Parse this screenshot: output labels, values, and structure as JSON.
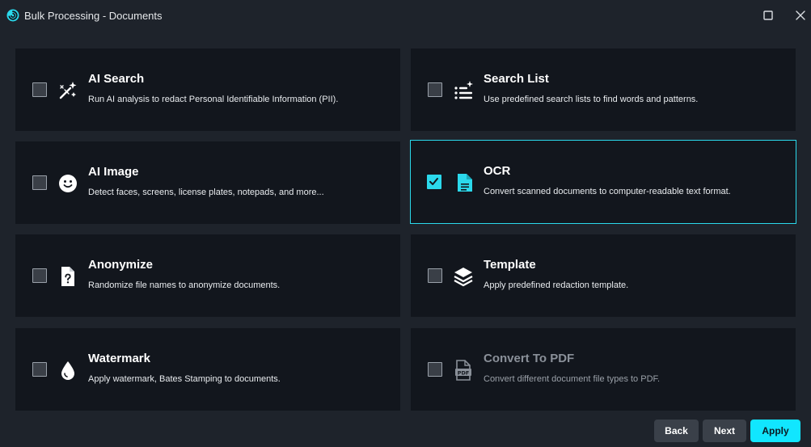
{
  "window": {
    "title": "Bulk Processing - Documents",
    "accent_color": "#2bd9ec"
  },
  "cards": [
    {
      "id": "ai-search",
      "title": "AI Search",
      "description": "Run AI analysis to redact Personal Identifiable Information (PII).",
      "icon": "magic-wand-icon",
      "checked": false,
      "disabled": false
    },
    {
      "id": "search-list",
      "title": "Search List",
      "description": "Use predefined search lists to find words and patterns.",
      "icon": "list-sparkle-icon",
      "checked": false,
      "disabled": false
    },
    {
      "id": "ai-image",
      "title": "AI Image",
      "description": "Detect faces, screens, license plates, notepads, and more...",
      "icon": "smiley-face-icon",
      "checked": false,
      "disabled": false
    },
    {
      "id": "ocr",
      "title": "OCR",
      "description": "Convert scanned documents to computer-readable text format.",
      "icon": "document-text-icon",
      "checked": true,
      "disabled": false
    },
    {
      "id": "anonymize",
      "title": "Anonymize",
      "description": "Randomize file names to anonymize documents.",
      "icon": "document-question-icon",
      "checked": false,
      "disabled": false
    },
    {
      "id": "template",
      "title": "Template",
      "description": "Apply predefined redaction template.",
      "icon": "layers-icon",
      "checked": false,
      "disabled": false
    },
    {
      "id": "watermark",
      "title": "Watermark",
      "description": "Apply watermark, Bates Stamping to documents.",
      "icon": "water-drop-icon",
      "checked": false,
      "disabled": false
    },
    {
      "id": "convert-pdf",
      "title": "Convert To PDF",
      "description": "Convert different document file types to PDF.",
      "icon": "pdf-file-icon",
      "checked": false,
      "disabled": true
    }
  ],
  "footer": {
    "back_label": "Back",
    "next_label": "Next",
    "apply_label": "Apply"
  }
}
